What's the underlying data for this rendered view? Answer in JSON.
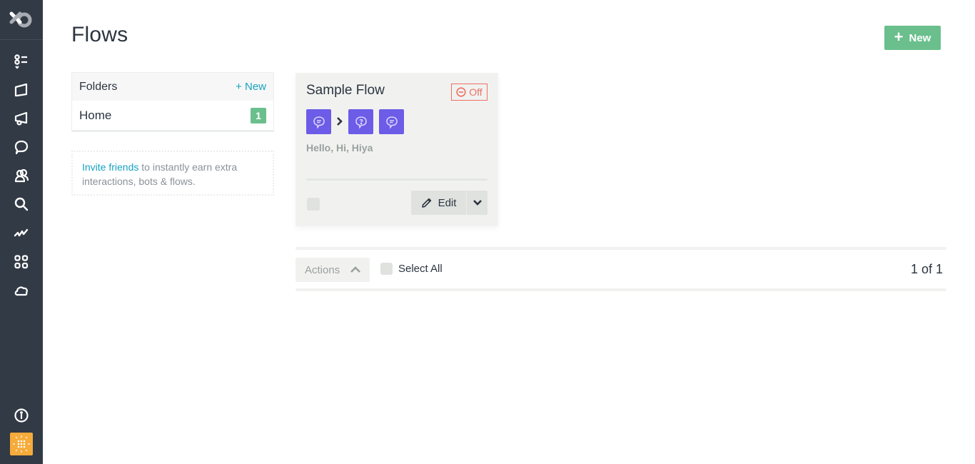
{
  "sidebar": {
    "logo": "logo-icon",
    "items": [
      {
        "name": "tasks",
        "icon": "list-icon"
      },
      {
        "name": "broadcasts",
        "icon": "flag-icon"
      },
      {
        "name": "campaigns",
        "icon": "megaphone-icon"
      },
      {
        "name": "conversations",
        "icon": "chat-bubble-icon"
      },
      {
        "name": "contacts",
        "icon": "users-icon"
      },
      {
        "name": "search",
        "icon": "search-icon"
      },
      {
        "name": "analytics",
        "icon": "activity-icon"
      },
      {
        "name": "apps",
        "icon": "grid-icon"
      },
      {
        "name": "cloud",
        "icon": "cloud-icon"
      }
    ],
    "bottom": [
      {
        "name": "info",
        "icon": "info-icon"
      },
      {
        "name": "avatar",
        "icon": "avatar",
        "color": "#f6ab3a"
      }
    ]
  },
  "header": {
    "title": "Flows",
    "new_label": "New"
  },
  "folders": {
    "title": "Folders",
    "add_label": "+ New",
    "items": [
      {
        "name": "Home",
        "count": "1"
      }
    ]
  },
  "invite": {
    "link": "Invite friends",
    "text": " to instantly earn extra interactions, bots & flows."
  },
  "flows": [
    {
      "title": "Sample Flow",
      "status": "Off",
      "steps": [
        "message-icon",
        "question-icon",
        "message-icon"
      ],
      "preview": "Hello, Hi, Hiya",
      "edit_label": "Edit"
    }
  ],
  "toolbar": {
    "actions_label": "Actions",
    "select_all_label": "Select All",
    "pagination": "1 of 1"
  },
  "colors": {
    "sidebar": "#323a45",
    "accent_green": "#6abf8c",
    "link": "#17a2c0",
    "step_purple": "#6c5ce7",
    "status_off": "#ec6f63"
  }
}
